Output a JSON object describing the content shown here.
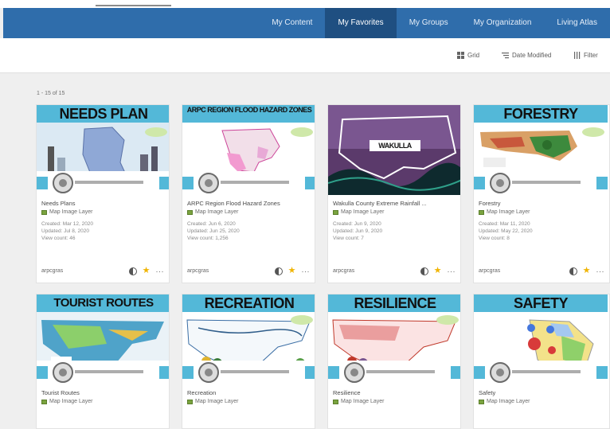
{
  "nav": {
    "tabs": [
      {
        "label": "My Content",
        "active": false
      },
      {
        "label": "My Favorites",
        "active": true
      },
      {
        "label": "My Groups",
        "active": false
      },
      {
        "label": "My Organization",
        "active": false
      },
      {
        "label": "Living Atlas",
        "active": false
      }
    ]
  },
  "toolbar": {
    "view_label": "Grid",
    "sort_label": "Date Modified",
    "filter_label": "Filter"
  },
  "results": {
    "count_label": "1 - 15 of 15"
  },
  "cards": [
    {
      "thumb_title": "NEEDS PLAN",
      "name": "Needs Plans",
      "type": "Map Image Layer",
      "created": "Created: Mar 12, 2020",
      "updated": "Updated: Jul 8, 2020",
      "views": "View count: 46",
      "owner": "arpcgras"
    },
    {
      "thumb_title": "ARPC REGION FLOOD HAZARD ZONES",
      "name": "ARPC Region Flood Hazard Zones",
      "type": "Map Image Layer",
      "created": "Created: Jun 6, 2020",
      "updated": "Updated: Jun 25, 2020",
      "views": "View count: 1,256",
      "owner": "arpcgras"
    },
    {
      "thumb_title": "WAKULLA",
      "name": "Wakulla County Extreme Rainfall ...",
      "type": "Map Image Layer",
      "created": "Created: Jun 9, 2020",
      "updated": "Updated: Jun 9, 2020",
      "views": "View count: 7",
      "owner": "arpcgras"
    },
    {
      "thumb_title": "FORESTRY",
      "name": "Forestry",
      "type": "Map Image Layer",
      "created": "Created: Mar 11, 2020",
      "updated": "Updated: May 22, 2020",
      "views": "View count: 8",
      "owner": "arpcgras"
    },
    {
      "thumb_title": "TOURIST ROUTES",
      "name": "Tourist Routes",
      "type": "Map Image Layer"
    },
    {
      "thumb_title": "RECREATION",
      "name": "Recreation",
      "type": "Map Image Layer"
    },
    {
      "thumb_title": "RESILIENCE",
      "name": "Resilience",
      "type": "Map Image Layer"
    },
    {
      "thumb_title": "SAFETY",
      "name": "Safety",
      "type": "Map Image Layer"
    }
  ],
  "colors": {
    "nav": "#2f6dab",
    "nav_active": "#1f4f81",
    "banner": "#53b8d8",
    "favorite_star": "#f0b400"
  }
}
